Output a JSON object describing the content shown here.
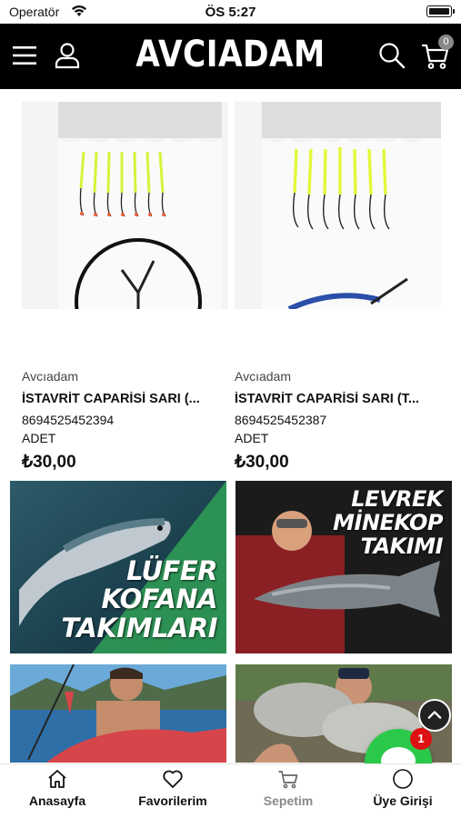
{
  "status_bar": {
    "carrier": "Operatör",
    "time": "ÖS 5:27"
  },
  "header": {
    "logo": "AVCIADAM",
    "cart_count": "0"
  },
  "products": [
    {
      "brand": "Avcıadam",
      "name": "İSTAVRİT CAPARİSİ SARI (...",
      "barcode": "8694525452394",
      "unit": "ADET",
      "price": "₺30,00"
    },
    {
      "brand": "Avcıadam",
      "name": "İSTAVRİT CAPARİSİ SARI (T...",
      "barcode": "8694525452387",
      "unit": "ADET",
      "price": "₺30,00"
    }
  ],
  "banners": [
    {
      "text_lines": [
        "LÜFER",
        "KOFANA",
        "TAKIMLARI"
      ]
    },
    {
      "text_lines": [
        "LEVREK",
        "MİNEKOP",
        "TAKIMI"
      ]
    }
  ],
  "chat": {
    "badge": "1"
  },
  "tabbar": {
    "home": "Anasayfa",
    "favorites": "Favorilerim",
    "cart": "Sepetim",
    "login": "Üye Girişi"
  },
  "colors": {
    "header_bg": "#000000",
    "chat_green": "#2bc94a",
    "badge_red": "#dd1111"
  },
  "icons": [
    "menu-icon",
    "user-icon",
    "search-icon",
    "cart-icon",
    "chevron-up-icon",
    "chat-bubble-icon",
    "home-icon",
    "heart-icon",
    "basket-icon",
    "user-circle-icon"
  ]
}
